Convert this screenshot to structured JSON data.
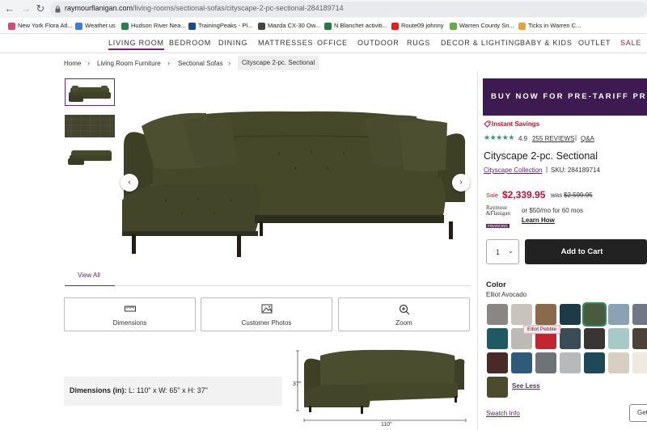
{
  "browser": {
    "url_domain": "raymourflanigan.com",
    "url_path": "/living-rooms/sectional-sofas/cityscape-2-pc-sectional-284189714",
    "bookmarks": [
      {
        "label": "New York Flora Atl...",
        "color": "#c94f7c"
      },
      {
        "label": "Weather.us",
        "color": "#3b7dd8"
      },
      {
        "label": "Hudson River Nea...",
        "color": "#2f7f4f"
      },
      {
        "label": "TrainingPeaks - Pl...",
        "color": "#1a4a8c"
      },
      {
        "label": "Mazda CX-30 Ow...",
        "color": "#444444"
      },
      {
        "label": "N Blanchet activiti...",
        "color": "#2b7a3d"
      },
      {
        "label": "Route09 johnny",
        "color": "#e02020"
      },
      {
        "label": "Warren County Sn...",
        "color": "#6aa84f"
      },
      {
        "label": "Ticks in Warren C...",
        "color": "#e6a23c"
      }
    ]
  },
  "site_nav": {
    "items": [
      "LIVING ROOM",
      "BEDROOM",
      "DINING",
      "MATTRESSES",
      "OFFICE",
      "OUTDOOR",
      "RUGS",
      "DECOR & LIGHTING",
      "BABY & KIDS",
      "OUTLET",
      "SALE"
    ]
  },
  "breadcrumb": {
    "items": [
      "Home",
      "Living Room Furniture",
      "Sectional Sofas"
    ],
    "current": "Cityscape 2-pc. Sectional"
  },
  "gallery": {
    "view_all": "View All",
    "features": [
      "Dimensions",
      "Customer Photos",
      "Zoom"
    ]
  },
  "dimensions": {
    "label": "Dimensions (in):",
    "value": "L: 110\" x W: 65\" x H: 37\"",
    "height_label": "37\"",
    "length_label": "110\""
  },
  "product": {
    "promo": "BUY NOW FOR PRE-TARIFF PR",
    "instant_savings": "Instant Savings",
    "stars": "★★★★★",
    "rating": "4.9",
    "reviews": "255 REVIEWS",
    "qa": "Q&A",
    "title": "Cityscape 2-pc. Sectional",
    "collection": "Cityscape Collection",
    "sku": "SKU: 284189714",
    "sale_label": "Sale",
    "sale_price": "$2,339.95",
    "was_label": "was",
    "was_price": "$2,599.95",
    "financing_brand_1": "Raymour",
    "financing_brand_2": "&Flanigan",
    "financing_brand_3": "FINANCING",
    "financing_text": "or $50/mo for 60 mos",
    "learn_how": "Learn How",
    "quantity": "1",
    "add_to_cart": "Add to Cart",
    "color_heading": "Color",
    "color_value": "Elliot Avocado",
    "tooltip": "Elliot Pebble",
    "see_less": "See Less",
    "swatch_info": "Swatch Info",
    "get_button": "Get"
  },
  "swatches": [
    [
      "#8a8683",
      "#c9c3bd",
      "#8a6a4a",
      "#1d3a46",
      "#4a5a3c",
      "#8ba1b4",
      "#6f7884"
    ],
    [
      "#1f5a64",
      "#bdbab5",
      "#c02530",
      "#3a4d57",
      "#3a3433",
      "#a7c9c7",
      "#4d4238"
    ],
    [
      "#4a2a26",
      "#2f5a7a",
      "#6e7377",
      "#b8b9bb",
      "#1d4a57",
      "#d8cfc2",
      "#eeeae0"
    ],
    [
      "#4c4a2f"
    ]
  ]
}
